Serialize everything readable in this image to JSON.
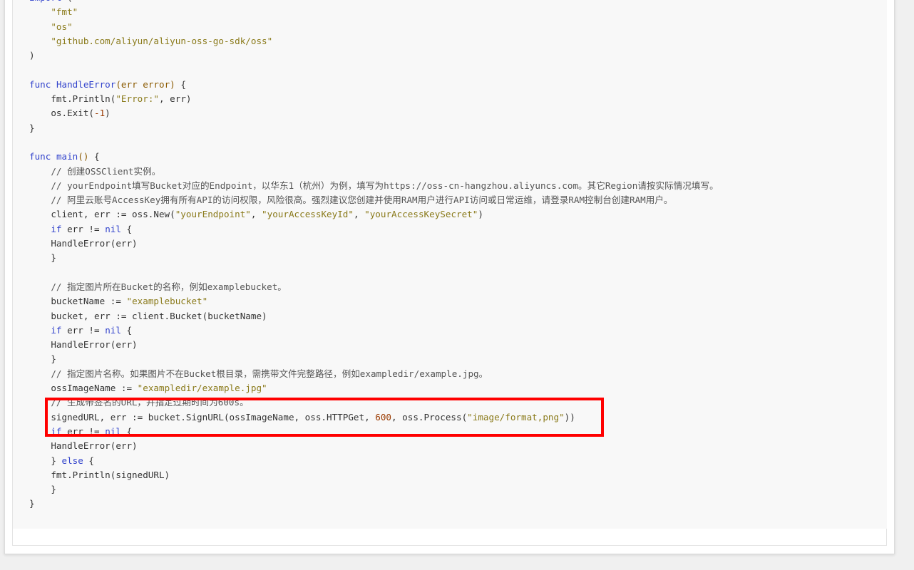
{
  "colors": {
    "keyword": "#3344cc",
    "string": "#8a7a1a",
    "type": "#8b5a00",
    "number": "#9a3a00",
    "comment": "#555555",
    "text": "#333333",
    "highlight": "#ff0000",
    "code_background": "#f8f8f8"
  },
  "code": {
    "language": "go",
    "lines": [
      [
        {
          "t": "kw",
          "v": "import"
        },
        {
          "t": "plain",
          "v": " ("
        }
      ],
      [
        {
          "t": "plain",
          "v": "    "
        },
        {
          "t": "str",
          "v": "\"fmt\""
        }
      ],
      [
        {
          "t": "plain",
          "v": "    "
        },
        {
          "t": "str",
          "v": "\"os\""
        }
      ],
      [
        {
          "t": "plain",
          "v": "    "
        },
        {
          "t": "str",
          "v": "\"github.com/aliyun/aliyun-oss-go-sdk/oss\""
        }
      ],
      [
        {
          "t": "plain",
          "v": ")"
        }
      ],
      [],
      [
        {
          "t": "kw",
          "v": "func"
        },
        {
          "t": "plain",
          "v": " "
        },
        {
          "t": "fn",
          "v": "HandleError"
        },
        {
          "t": "type",
          "v": "(err error)"
        },
        {
          "t": "plain",
          "v": " {"
        }
      ],
      [
        {
          "t": "plain",
          "v": "    fmt.Println("
        },
        {
          "t": "str",
          "v": "\"Error:\""
        },
        {
          "t": "plain",
          "v": ", err)"
        }
      ],
      [
        {
          "t": "plain",
          "v": "    os.Exit("
        },
        {
          "t": "num",
          "v": "-1"
        },
        {
          "t": "plain",
          "v": ")"
        }
      ],
      [
        {
          "t": "plain",
          "v": "}"
        }
      ],
      [],
      [
        {
          "t": "kw",
          "v": "func"
        },
        {
          "t": "plain",
          "v": " "
        },
        {
          "t": "fn",
          "v": "main"
        },
        {
          "t": "type",
          "v": "()"
        },
        {
          "t": "plain",
          "v": " {"
        }
      ],
      [
        {
          "t": "plain",
          "v": "    "
        },
        {
          "t": "com",
          "v": "// 创建OSSClient实例。"
        }
      ],
      [
        {
          "t": "plain",
          "v": "    "
        },
        {
          "t": "com",
          "v": "// yourEndpoint填写Bucket对应的Endpoint，以华东1（杭州）为例，填写为https://oss-cn-hangzhou.aliyuncs.com。其它Region请按实际情况填写。"
        }
      ],
      [
        {
          "t": "plain",
          "v": "    "
        },
        {
          "t": "com",
          "v": "// 阿里云账号AccessKey拥有所有API的访问权限，风险很高。强烈建议您创建并使用RAM用户进行API访问或日常运维，请登录RAM控制台创建RAM用户。"
        }
      ],
      [
        {
          "t": "plain",
          "v": "    client, err := oss.New("
        },
        {
          "t": "str",
          "v": "\"yourEndpoint\""
        },
        {
          "t": "plain",
          "v": ", "
        },
        {
          "t": "str",
          "v": "\"yourAccessKeyId\""
        },
        {
          "t": "plain",
          "v": ", "
        },
        {
          "t": "str",
          "v": "\"yourAccessKeySecret\""
        },
        {
          "t": "plain",
          "v": ")"
        }
      ],
      [
        {
          "t": "plain",
          "v": "    "
        },
        {
          "t": "kw",
          "v": "if"
        },
        {
          "t": "plain",
          "v": " err != "
        },
        {
          "t": "kw",
          "v": "nil"
        },
        {
          "t": "plain",
          "v": " {"
        }
      ],
      [
        {
          "t": "plain",
          "v": "    HandleError(err)"
        }
      ],
      [
        {
          "t": "plain",
          "v": "    }"
        }
      ],
      [],
      [
        {
          "t": "plain",
          "v": "    "
        },
        {
          "t": "com",
          "v": "// 指定图片所在Bucket的名称，例如examplebucket。"
        }
      ],
      [
        {
          "t": "plain",
          "v": "    bucketName := "
        },
        {
          "t": "str",
          "v": "\"examplebucket\""
        }
      ],
      [
        {
          "t": "plain",
          "v": "    bucket, err := client.Bucket(bucketName)"
        }
      ],
      [
        {
          "t": "plain",
          "v": "    "
        },
        {
          "t": "kw",
          "v": "if"
        },
        {
          "t": "plain",
          "v": " err != "
        },
        {
          "t": "kw",
          "v": "nil"
        },
        {
          "t": "plain",
          "v": " {"
        }
      ],
      [
        {
          "t": "plain",
          "v": "    HandleError(err)"
        }
      ],
      [
        {
          "t": "plain",
          "v": "    }"
        }
      ],
      [
        {
          "t": "plain",
          "v": "    "
        },
        {
          "t": "com",
          "v": "// 指定图片名称。如果图片不在Bucket根目录，需携带文件完整路径，例如exampledir/example.jpg。"
        }
      ],
      [
        {
          "t": "plain",
          "v": "    ossImageName := "
        },
        {
          "t": "str",
          "v": "\"exampledir/example.jpg\""
        }
      ],
      [
        {
          "t": "plain",
          "v": "    "
        },
        {
          "t": "com",
          "v": "// 生成带签名的URL，并指定过期时间为600s。"
        }
      ],
      [
        {
          "t": "plain",
          "v": "    signedURL, err := bucket.SignURL(ossImageName, oss.HTTPGet, "
        },
        {
          "t": "num",
          "v": "600"
        },
        {
          "t": "plain",
          "v": ", oss.Process("
        },
        {
          "t": "str",
          "v": "\"image/format,png\""
        },
        {
          "t": "plain",
          "v": "))"
        }
      ],
      [
        {
          "t": "plain",
          "v": "    "
        },
        {
          "t": "kw",
          "v": "if"
        },
        {
          "t": "plain",
          "v": " err != "
        },
        {
          "t": "kw",
          "v": "nil"
        },
        {
          "t": "plain",
          "v": " {"
        }
      ],
      [
        {
          "t": "plain",
          "v": "    HandleError(err)"
        }
      ],
      [
        {
          "t": "plain",
          "v": "    } "
        },
        {
          "t": "kw",
          "v": "else"
        },
        {
          "t": "plain",
          "v": " {"
        }
      ],
      [
        {
          "t": "plain",
          "v": "    fmt.Println(signedURL)"
        }
      ],
      [
        {
          "t": "plain",
          "v": "    }"
        }
      ],
      [
        {
          "t": "plain",
          "v": "}"
        }
      ]
    ]
  }
}
